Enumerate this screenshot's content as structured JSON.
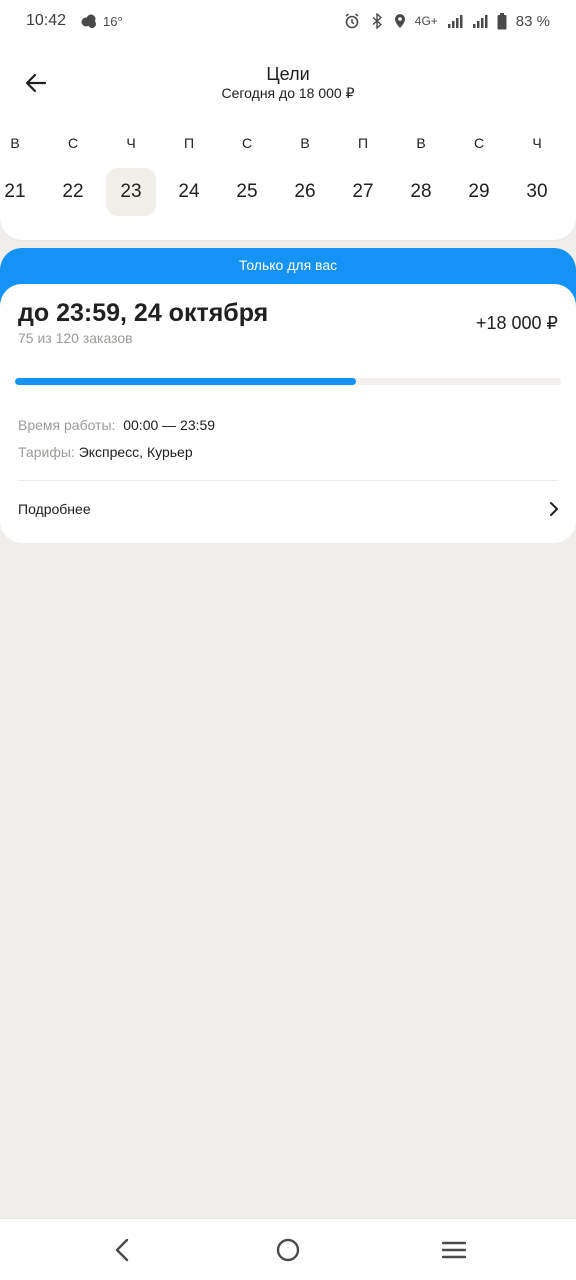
{
  "status_bar": {
    "time": "10:42",
    "temperature": "16°",
    "network": "4G+",
    "battery": "83 %"
  },
  "header": {
    "title": "Цели",
    "subtitle": "Сегодня до 18 000 ₽",
    "back_icon": "arrow-left-icon"
  },
  "calendar": {
    "days": [
      {
        "dow": "В",
        "num": "21"
      },
      {
        "dow": "С",
        "num": "22"
      },
      {
        "dow": "Ч",
        "num": "23"
      },
      {
        "dow": "П",
        "num": "24"
      },
      {
        "dow": "С",
        "num": "25"
      },
      {
        "dow": "В",
        "num": "26"
      },
      {
        "dow": "П",
        "num": "27"
      },
      {
        "dow": "В",
        "num": "28"
      },
      {
        "dow": "С",
        "num": "29"
      },
      {
        "dow": "Ч",
        "num": "30"
      }
    ],
    "selected_index": 2
  },
  "offer": {
    "banner": "Только для вас",
    "deadline": "до 23:59, 24 октября",
    "orders_progress": "75 из 120 заказов",
    "bonus": "+18 000 ₽",
    "progress_fraction": 0.625,
    "work_time_label": "Время работы:",
    "work_time_value": "00:00 — 23:59",
    "tariffs_label": "Тарифы:",
    "tariffs_value": "Экспресс, Курьер",
    "more_label": "Подробнее"
  },
  "colors": {
    "accent": "#1493f5",
    "background": "#efeeea",
    "card": "#ffffff",
    "muted_text": "#9e9b98"
  },
  "nav_bar": {
    "icons": [
      "back-nav-icon",
      "home-nav-icon",
      "menu-nav-icon"
    ]
  }
}
